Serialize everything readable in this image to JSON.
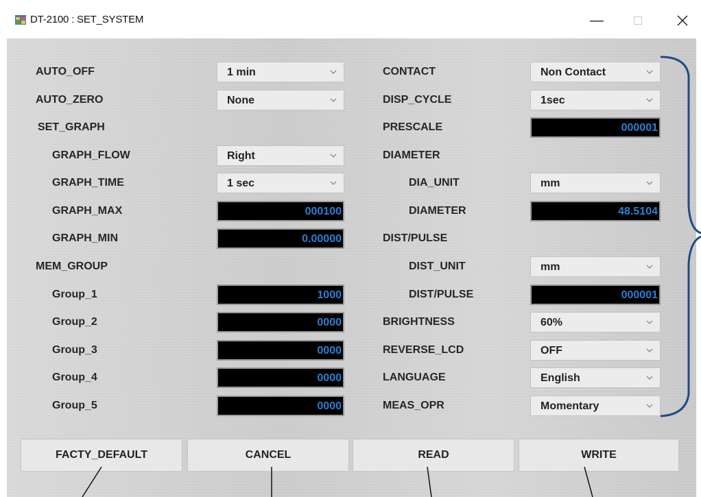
{
  "window": {
    "title": "DT-2100 : SET_SYSTEM"
  },
  "left": {
    "auto_off": {
      "label": "AUTO_OFF",
      "value": "1 min"
    },
    "auto_zero": {
      "label": "AUTO_ZERO",
      "value": "None"
    },
    "set_graph": {
      "label": "SET_GRAPH"
    },
    "graph_flow": {
      "label": "GRAPH_FLOW",
      "value": "Right"
    },
    "graph_time": {
      "label": "GRAPH_TIME",
      "value": "1 sec"
    },
    "graph_max": {
      "label": "GRAPH_MAX",
      "value": "000100"
    },
    "graph_min": {
      "label": "GRAPH_MIN",
      "value": "0.00000"
    },
    "mem_group": {
      "label": "MEM_GROUP"
    },
    "groups": [
      {
        "label": "Group_1",
        "value": "1000"
      },
      {
        "label": "Group_2",
        "value": "0000"
      },
      {
        "label": "Group_3",
        "value": "0000"
      },
      {
        "label": "Group_4",
        "value": "0000"
      },
      {
        "label": "Group_5",
        "value": "0000"
      }
    ]
  },
  "right": {
    "contact": {
      "label": "CONTACT",
      "value": "Non Contact"
    },
    "disp_cycle": {
      "label": "DISP_CYCLE",
      "value": "1sec"
    },
    "prescale": {
      "label": "PRESCALE",
      "value": "000001"
    },
    "diameter_group": {
      "label": "DIAMETER"
    },
    "dia_unit": {
      "label": "DIA_UNIT",
      "value": "mm"
    },
    "diameter": {
      "label": "DIAMETER",
      "value": "48.5104"
    },
    "dist_pulse_group": {
      "label": "DIST/PULSE"
    },
    "dist_unit": {
      "label": "DIST_UNIT",
      "value": "mm"
    },
    "dist_pulse": {
      "label": "DIST/PULSE",
      "value": "000001"
    },
    "brightness": {
      "label": "BRIGHTNESS",
      "value": "60%"
    },
    "reverse_lcd": {
      "label": "REVERSE_LCD",
      "value": "OFF"
    },
    "language": {
      "label": "LANGUAGE",
      "value": "English"
    },
    "meas_opr": {
      "label": "MEAS_OPR",
      "value": "Momentary"
    }
  },
  "buttons": {
    "facty_default": "FACTY_DEFAULT",
    "cancel": "CANCEL",
    "read": "READ",
    "write": "WRITE"
  },
  "icons": {
    "app": "app-window-icon",
    "minimize": "minimize-icon",
    "maximize": "maximize-icon",
    "close": "close-icon",
    "dropdown": "chevron-down-icon"
  },
  "colors": {
    "field_text": "#2b7fd4",
    "annotation": "#1f4a86"
  }
}
